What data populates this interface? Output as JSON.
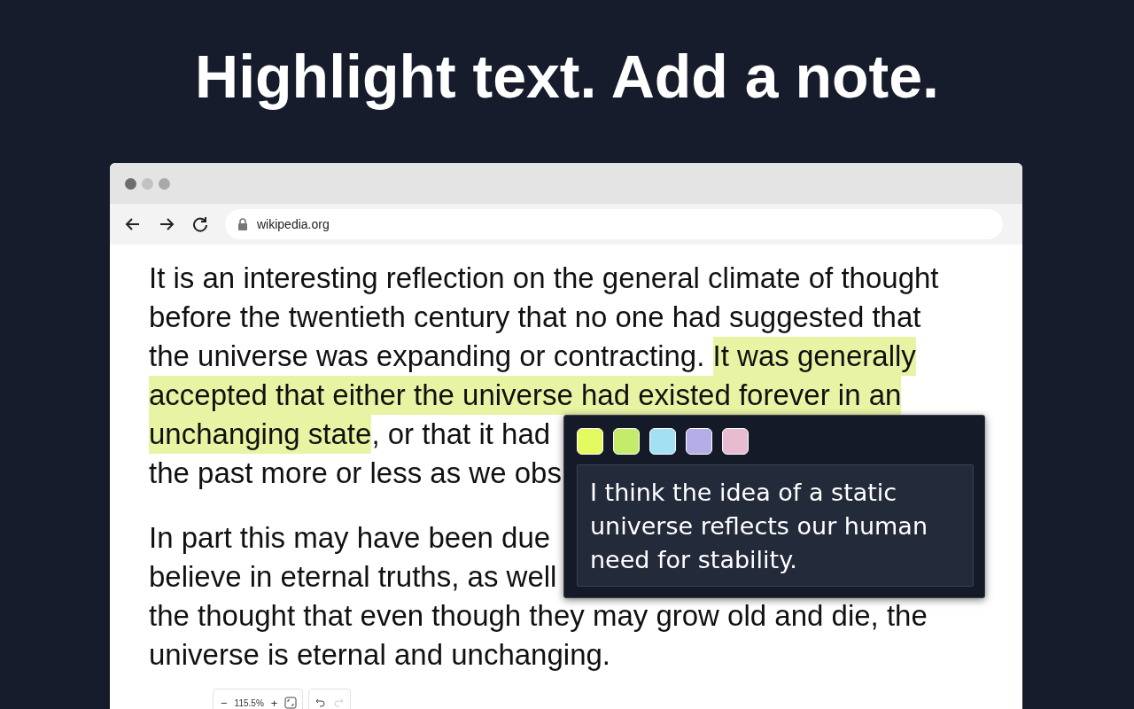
{
  "headline": "Highlight text. Add a note.",
  "browser": {
    "url": "wikipedia.org"
  },
  "paragraphs": [
    {
      "lines": [
        [
          {
            "text": "It is an interesting reflection on the general climate of thought",
            "highlighted": false
          }
        ],
        [
          {
            "text": "before the twentieth century that no one had suggested that",
            "highlighted": false
          }
        ],
        [
          {
            "text": "the universe was expanding or contracting. ",
            "highlighted": false
          },
          {
            "text": "It was generally",
            "highlighted": true
          }
        ],
        [
          {
            "text": "accepted that either the universe had existed forever in an",
            "highlighted": true
          }
        ],
        [
          {
            "text": "unchanging state",
            "highlighted": true
          },
          {
            "text": ", or that it had",
            "highlighted": false
          }
        ],
        [
          {
            "text": "the past more or less as we obs",
            "highlighted": false
          }
        ]
      ]
    },
    {
      "lines": [
        [
          {
            "text": "In part this may have been due",
            "highlighted": false
          }
        ],
        [
          {
            "text": "believe in eternal truths, as well",
            "highlighted": false
          }
        ],
        [
          {
            "text": "the thought that even though they may grow old and die, the",
            "highlighted": false
          }
        ],
        [
          {
            "text": "universe is eternal and unchanging.",
            "highlighted": false
          }
        ]
      ]
    }
  ],
  "note_popup": {
    "swatches": [
      {
        "color": "#e4f95f"
      },
      {
        "color": "#c4ec6a"
      },
      {
        "color": "#a4e0f3"
      },
      {
        "color": "#b5ade6"
      },
      {
        "color": "#e8bcd0"
      }
    ],
    "note": "I think the idea of a static universe reflects our human need for stability."
  },
  "zoom_toolbar": {
    "zoom_out": "−",
    "zoom_level": "115.5%",
    "zoom_in": "+",
    "undo_disabled": false,
    "redo_disabled": true
  }
}
